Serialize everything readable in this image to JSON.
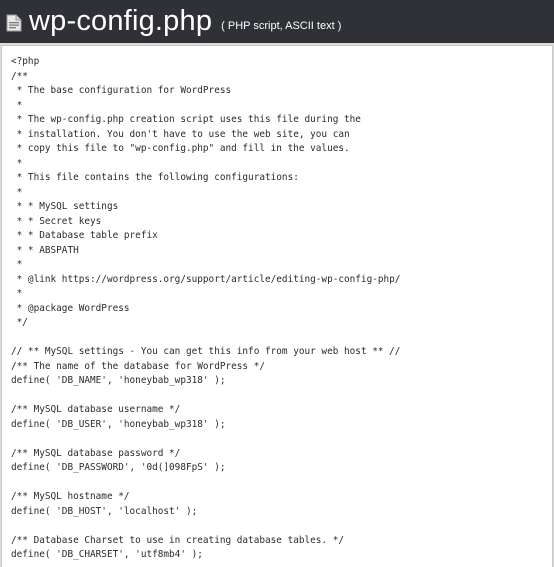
{
  "window": {
    "file_name": "wp-config.php",
    "file_type": "( PHP script, ASCII text )",
    "icon": "document-icon"
  },
  "code_lines": [
    "<?php",
    "/**",
    " * The base configuration for WordPress",
    " *",
    " * The wp-config.php creation script uses this file during the",
    " * installation. You don't have to use the web site, you can",
    " * copy this file to \"wp-config.php\" and fill in the values.",
    " *",
    " * This file contains the following configurations:",
    " *",
    " * * MySQL settings",
    " * * Secret keys",
    " * * Database table prefix",
    " * * ABSPATH",
    " *",
    " * @link https://wordpress.org/support/article/editing-wp-config-php/",
    " *",
    " * @package WordPress",
    " */",
    "",
    "// ** MySQL settings - You can get this info from your web host ** //",
    "/** The name of the database for WordPress */",
    "define( 'DB_NAME', 'honeybab_wp318' );",
    "",
    "/** MySQL database username */",
    "define( 'DB_USER', 'honeybab_wp318' );",
    "",
    "/** MySQL database password */",
    "define( 'DB_PASSWORD', '0d(]098FpS' );",
    "",
    "/** MySQL hostname */",
    "define( 'DB_HOST', 'localhost' );",
    "",
    "/** Database Charset to use in creating database tables. */",
    "define( 'DB_CHARSET', 'utf8mb4' );"
  ]
}
